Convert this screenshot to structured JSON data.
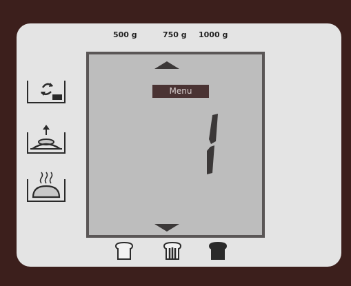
{
  "weights": [
    "500 g",
    "750 g",
    "1000 g"
  ],
  "display": {
    "menu_label": "Menu",
    "program_number": "1"
  },
  "program_icons": [
    "knead-icon",
    "rise-icon",
    "bake-icon"
  ],
  "crust_icons": [
    "crust-light-icon",
    "crust-medium-icon",
    "crust-dark-icon"
  ],
  "colors": {
    "frame": "#3c1f1c",
    "panel": "#e4e4e4",
    "lcd": "#bdbdbd",
    "segment": "#3b3838"
  }
}
